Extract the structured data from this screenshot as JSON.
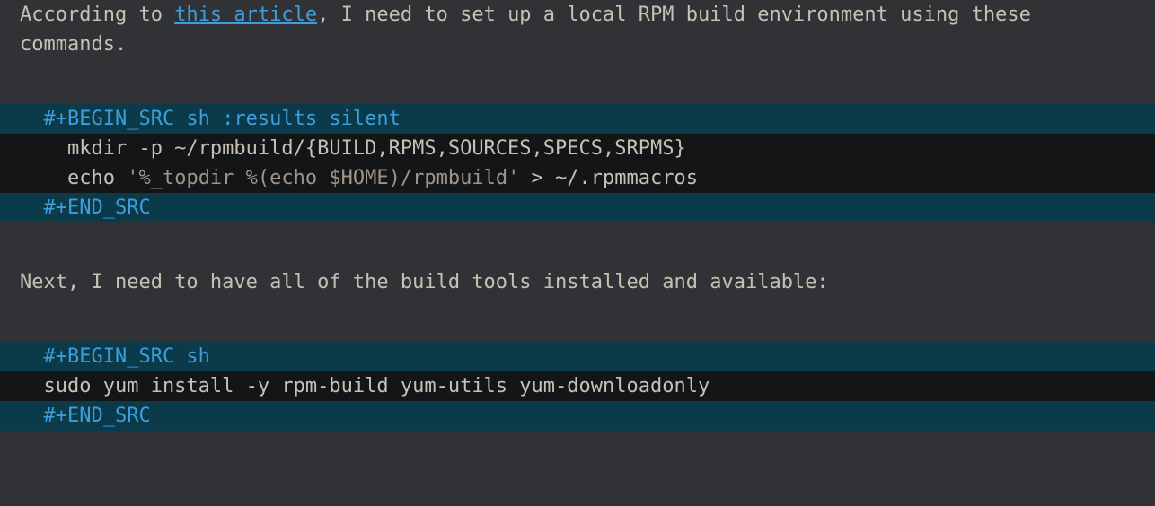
{
  "para1": {
    "pre": "According to ",
    "link": "this article",
    "post": ", I need to set up a local RPM build environment using these commands."
  },
  "block1": {
    "begin": "  #+BEGIN_SRC sh :results silent",
    "line1": "    mkdir -p ~/rpmbuild/{BUILD,RPMS,SOURCES,SPECS,SRPMS}",
    "line2a": "    echo ",
    "line2str": "'%_topdir %(echo $HOME)/rpmbuild'",
    "line2b": " > ~/.rpmmacros",
    "end": "  #+END_SRC"
  },
  "para2": "Next, I need to have all of the build tools installed and available:",
  "block2": {
    "begin": "  #+BEGIN_SRC sh",
    "line1": "  sudo yum install -y rpm-build yum-utils yum-downloadonly",
    "end": "  #+END_SRC"
  }
}
